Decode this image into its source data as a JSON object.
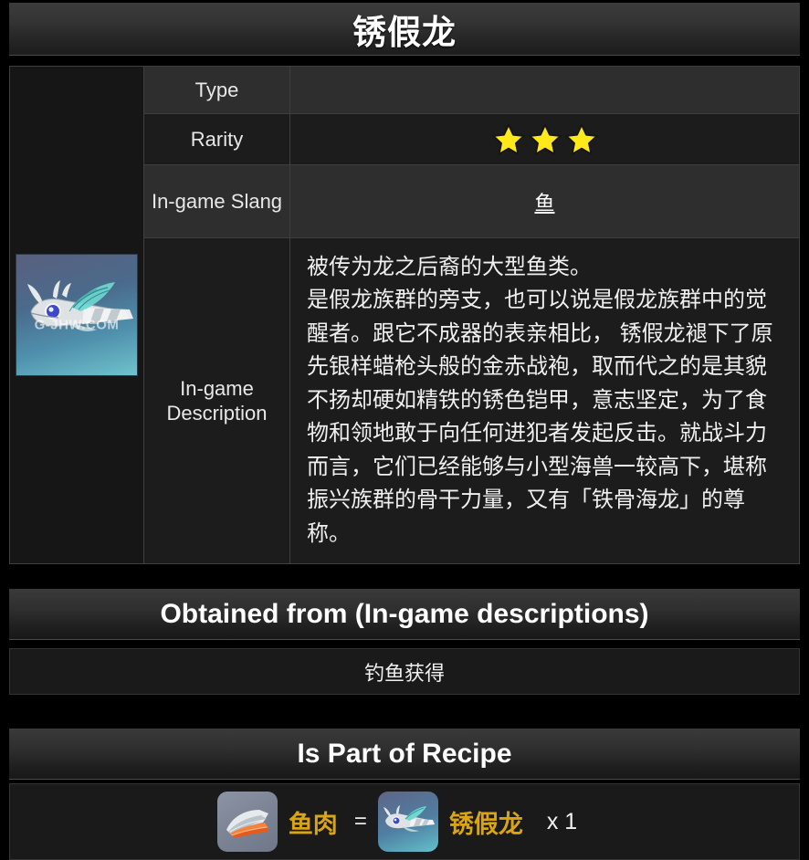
{
  "page": {
    "title": "锈假龙"
  },
  "info_table": {
    "rows": [
      {
        "label": "Type",
        "value": ""
      },
      {
        "label": "Rarity",
        "value": "",
        "stars": 3
      },
      {
        "label": "In-game Slang",
        "value": "鱼"
      },
      {
        "label": "In-game Description",
        "value": "被传为龙之后裔的大型鱼类。\n是假龙族群的旁支，也可以说是假龙族群中的觉醒者。跟它不成器的表亲相比， 锈假龙褪下了原先银样蜡枪头般的金赤战袍，取而代之的是其貌不扬却硬如精铁的锈色铠甲，意志坚定，为了食物和领地敢于向任何进犯者发起反击。就战斗力而言，它们已经能够与小型海兽一较高下，堪称振兴族群的骨干力量，又有「铁骨海龙」的尊称。"
      }
    ],
    "label_type": "Type",
    "label_rarity": "Rarity",
    "label_slang": "In-game Slang",
    "label_description": "In-game Description",
    "type_value": "",
    "slang_value": "鱼",
    "rarity_stars": 3,
    "description_line1": "被传为龙之后裔的大型鱼类。",
    "description_line2": "是假龙族群的旁支，也可以说是假龙族群中的觉醒者。跟它不成器的表亲相比， 锈假龙褪下了原先银样蜡枪头般的金赤战袍，取而代之的是其貌不扬却硬如精铁的锈色铠甲，意志坚定，为了食物和领地敢于向任何进犯者发起反击。就战斗力而言，它们已经能够与小型海兽一较高下，堪称振兴族群的骨干力量，又有「铁骨海龙」的尊称。",
    "thumbnail_watermark": "G-JHW.COM"
  },
  "obtained": {
    "header": "Obtained from (In-game descriptions)",
    "value": "钓鱼获得"
  },
  "recipe": {
    "header": "Is Part of Recipe",
    "result_name": "鱼肉",
    "equals": "=",
    "ingredient_name": "锈假龙",
    "quantity": "x 1"
  },
  "colors": {
    "background": "#000000",
    "panel": "#1c1c1c",
    "panel_alt": "#2e2e2e",
    "border": "#3f3f3f",
    "text": "#f0f0f0",
    "star": "#FFE81A",
    "item_name": "#d9a514",
    "header_gradient_top": "#3a3a3a"
  }
}
